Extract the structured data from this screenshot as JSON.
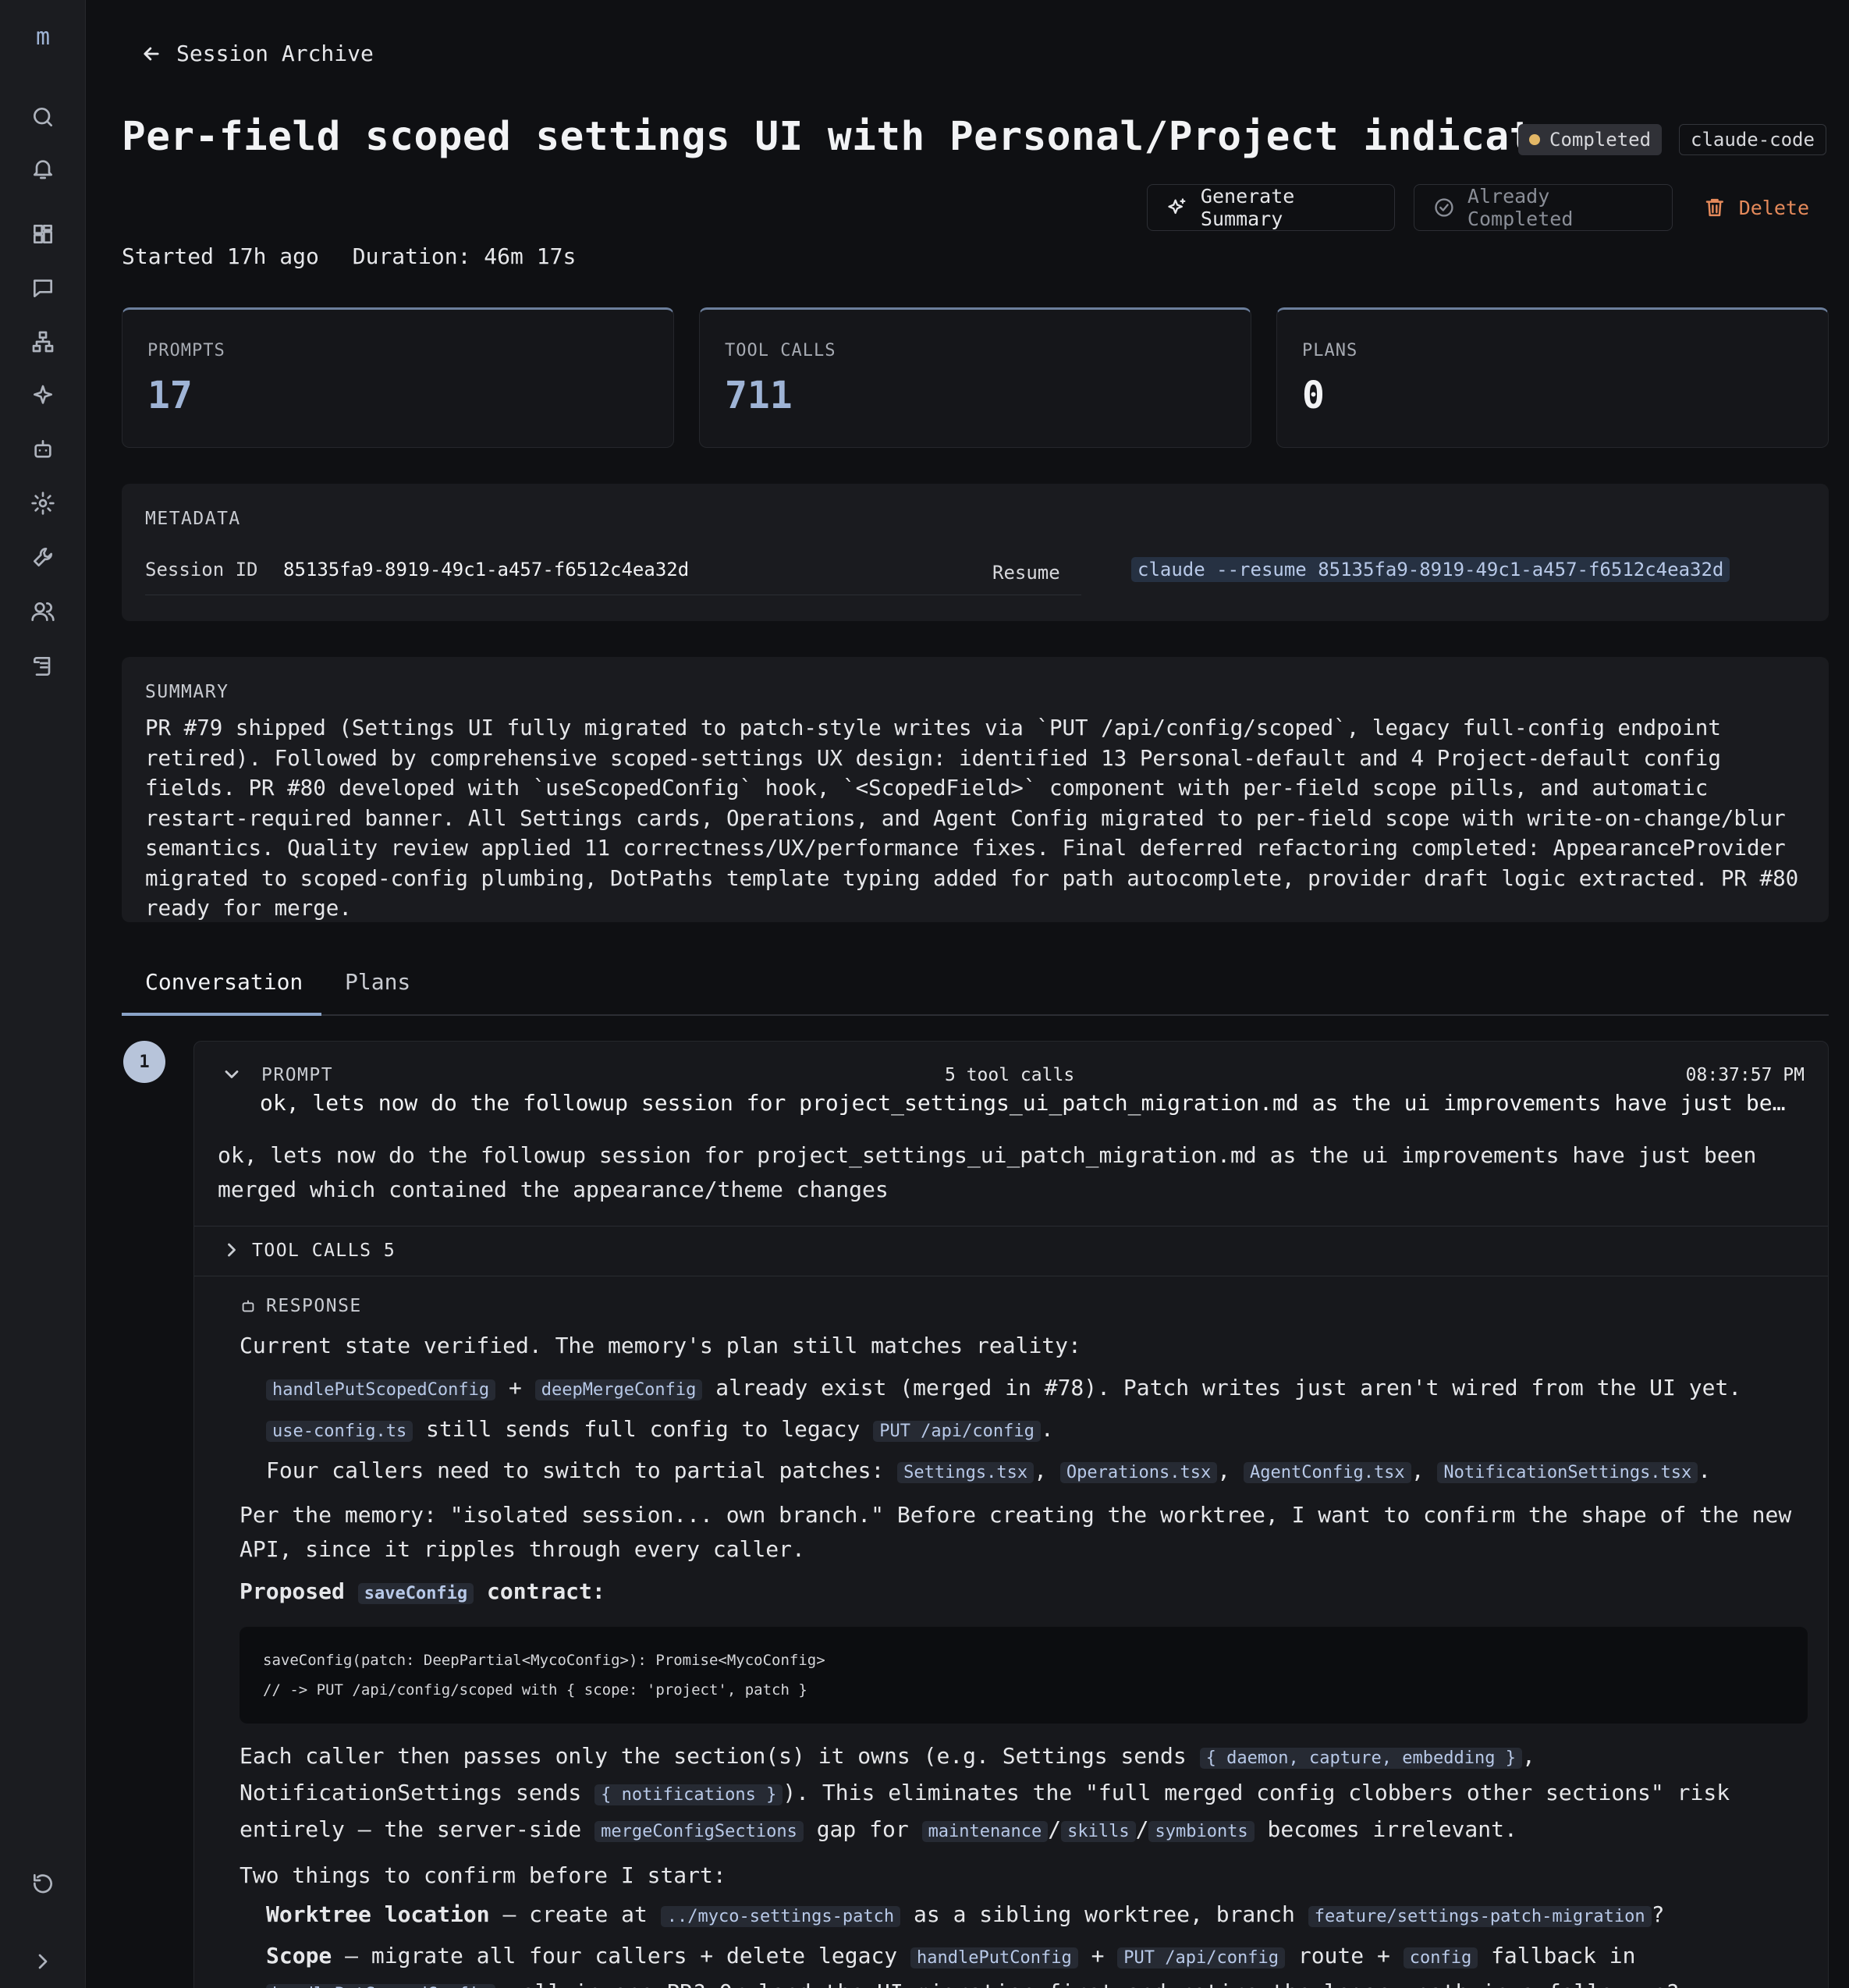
{
  "sidebar": {
    "logo": "m",
    "items": [
      "search-icon",
      "bell-icon",
      "dashboard-icon",
      "chat-icon",
      "network-icon",
      "sparkle-icon",
      "bot-icon",
      "gear-icon",
      "wrench-icon",
      "users-icon",
      "scroll-icon"
    ],
    "bottom": [
      "refresh-icon",
      "chevron-right-icon"
    ]
  },
  "header": {
    "back_label": "Session Archive",
    "title": "Per-field scoped settings UI with Personal/Project indicators",
    "status": "Completed",
    "agent_tag": "claude-code"
  },
  "actions": {
    "generate": "Generate Summary",
    "already_completed": "Already Completed",
    "delete": "Delete"
  },
  "session_info": {
    "started": "Started 17h ago",
    "duration": "Duration: 46m 17s"
  },
  "stats": [
    {
      "label": "PROMPTS",
      "value": "17"
    },
    {
      "label": "TOOL CALLS",
      "value": "711"
    },
    {
      "label": "PLANS",
      "value": "0"
    }
  ],
  "metadata": {
    "heading": "METADATA",
    "session_id_label": "Session ID",
    "session_id": "85135fa9-8919-49c1-a457-f6512c4ea32d",
    "resume_label": "Resume",
    "resume_cmd": "claude --resume 85135fa9-8919-49c1-a457-f6512c4ea32d"
  },
  "summary": {
    "heading": "SUMMARY",
    "text": "PR #79 shipped (Settings UI fully migrated to patch-style writes via `PUT /api/config/scoped`, legacy full-config endpoint retired). Followed by comprehensive scoped-settings UX design: identified 13 Personal-default and 4 Project-default config fields. PR #80 developed with `useScopedConfig` hook, `<ScopedField>` component with per-field scope pills, and automatic restart-required banner. All Settings cards, Operations, and Agent Config migrated to per-field scope with write-on-change/blur semantics. Quality review applied 11 correctness/UX/performance fixes. Final deferred refactoring completed: AppearanceProvider migrated to scoped-config plumbing, DotPaths template typing added for path autocomplete, provider draft logic extracted. PR #80 ready for merge."
  },
  "tabs": [
    "Conversation",
    "Plans"
  ],
  "thread": {
    "number": "1",
    "prompt_label": "PROMPT",
    "tool_calls_count": "5 tool calls",
    "time": "08:37:57 PM",
    "prompt_truncated": "ok, lets now do the followup session for project_settings_ui_patch_migration.md as the ui improvements have just been me…",
    "prompt_full": "ok, lets now do the followup session for project_settings_ui_patch_migration.md as the ui improvements have just been merged which contained the appearance/theme changes",
    "tool_calls_label": "TOOL CALLS 5",
    "response_label": "RESPONSE",
    "response": {
      "intro": "Current state verified. The memory's plan still matches reality:",
      "b1_code1": "handlePutScopedConfig",
      "b1_plus": "+",
      "b1_code2": "deepMergeConfig",
      "b1_text": "already exist (merged in #78). Patch writes just aren't wired from the UI yet.",
      "b2_code1": "use-config.ts",
      "b2_text": "still sends full config to legacy",
      "b2_code2": "PUT /api/config",
      "b2_end": ".",
      "b3_text": "Four callers need to switch to partial patches:",
      "b3_files": [
        "Settings.tsx",
        "Operations.tsx",
        "AgentConfig.tsx",
        "NotificationSettings.tsx"
      ],
      "b3_sep": ",",
      "b3_end": ".",
      "para1": "Per the memory: \"isolated session... own branch.\" Before creating the worktree, I want to confirm the shape of the new API, since it ripples through every caller.",
      "proposed_a": "Proposed",
      "proposed_code": "saveConfig",
      "proposed_b": "contract:",
      "code_line1": "saveConfig(patch: DeepPartial<MycoConfig>): Promise<MycoConfig>",
      "code_line2": "// -> PUT /api/config/scoped with { scope: 'project', patch }",
      "p2_a": "Each caller then passes only the section(s) it owns (e.g. Settings sends",
      "p2_code1": "{ daemon, capture, embedding }",
      "p2_b": ", NotificationSettings sends",
      "p2_code2": "{ notifications }",
      "p2_c": "). This eliminates the \"full merged config clobbers other sections\" risk entirely — the server-side",
      "p2_code3": "mergeConfigSections",
      "p2_d": "gap for",
      "p2_code4": "maintenance",
      "p2_slash": "/",
      "p2_code5": "skills",
      "p2_code6": "symbionts",
      "p2_e": "becomes irrelevant.",
      "two_things": "Two things to confirm before I start:",
      "w_label": "Worktree location",
      "w_a": "— create at",
      "w_code1": "../myco-settings-patch",
      "w_b": "as a sibling worktree, branch",
      "w_code2": "feature/settings-patch-migration",
      "w_q": "?",
      "s_label": "Scope",
      "s_a": "— migrate all four callers + delete legacy",
      "s_code1": "handlePutConfig",
      "s_plus": "+",
      "s_code2": "PUT /api/config",
      "s_b": "route +",
      "s_code3": "config",
      "s_c": "fallback in",
      "s_code4": "handlePutScopedConfig",
      "s_d": ", all in one PR? Or land the UI migration first and retire the legacy path in a follow-up?"
    }
  }
}
